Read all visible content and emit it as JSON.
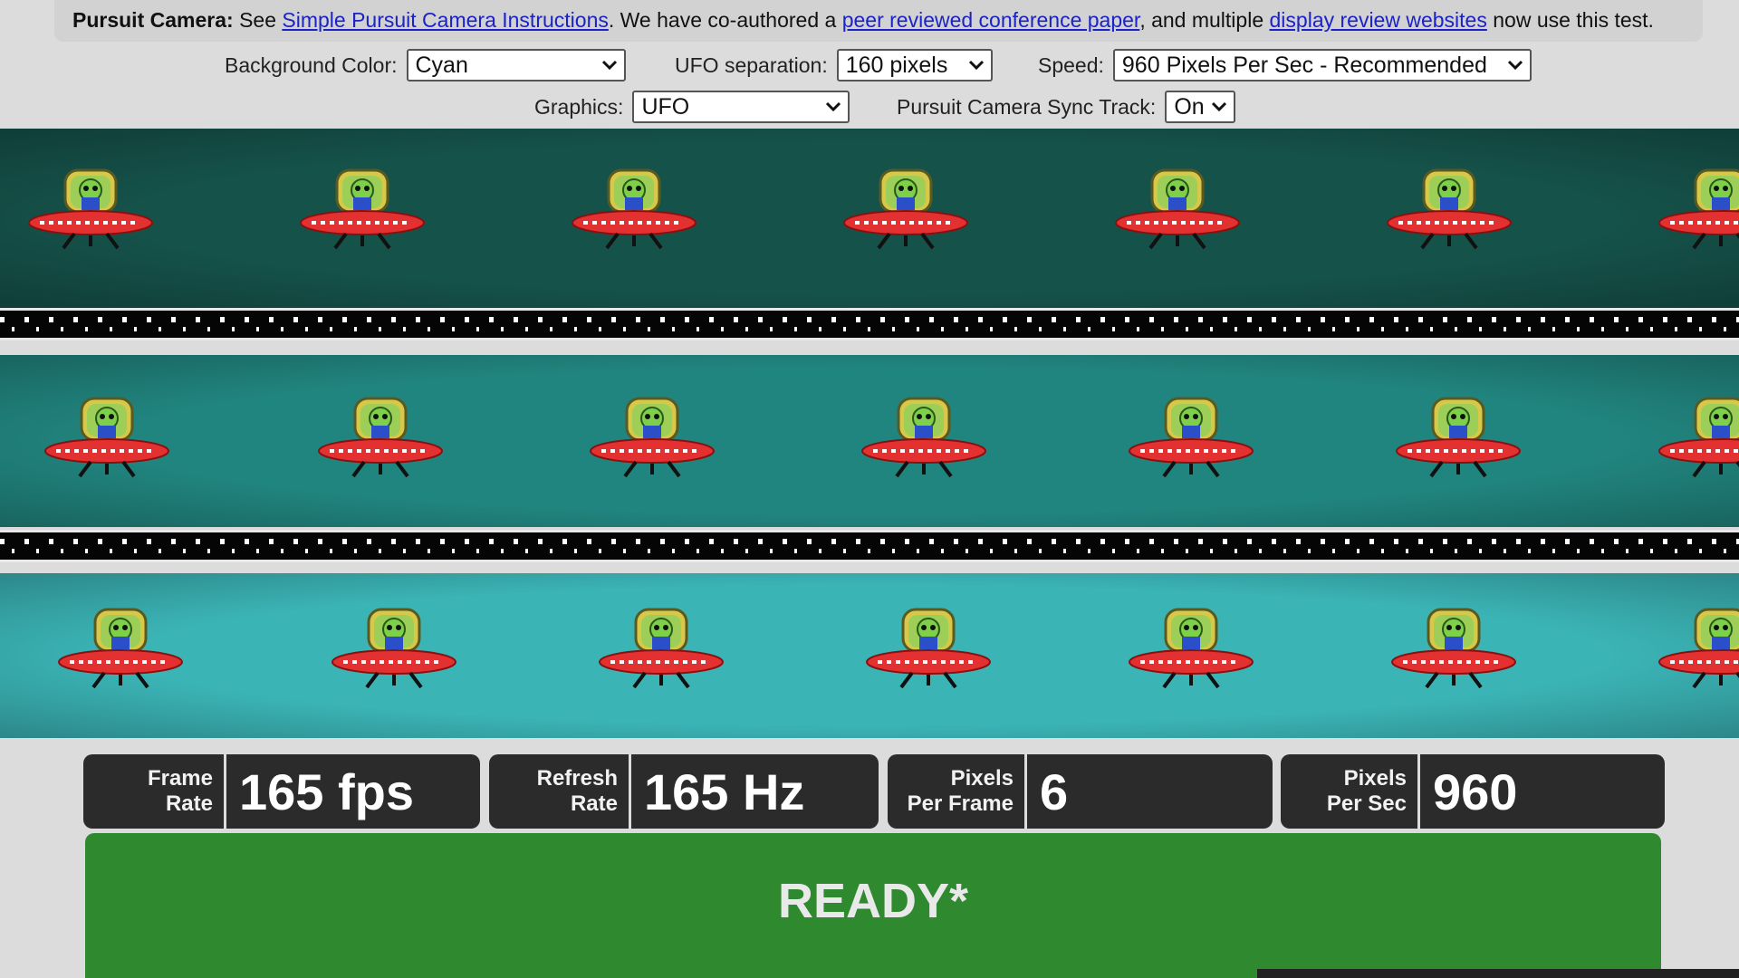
{
  "header": {
    "intro_bold": "Pursuit Camera:",
    "see": "See",
    "link1": "Simple Pursuit Camera Instructions",
    "text2": ". We have co-authored a",
    "link2": "peer reviewed conference paper",
    "text3": ", and multiple",
    "link3": "display review websites",
    "text4": "now use this test."
  },
  "controls": {
    "background_color": {
      "label": "Background Color:",
      "value": "Cyan"
    },
    "ufo_separation": {
      "label": "UFO separation:",
      "value": "160 pixels"
    },
    "speed": {
      "label": "Speed:",
      "value": "960 Pixels Per Sec - Recommended"
    },
    "graphics": {
      "label": "Graphics:",
      "value": "UFO"
    },
    "sync_track": {
      "label": "Pursuit Camera Sync Track:",
      "value": "On"
    }
  },
  "tracks": [
    {
      "color": "#15524a"
    },
    {
      "color": "#21857f"
    },
    {
      "color": "#3bb4b6"
    }
  ],
  "stats": {
    "frame_rate": {
      "label1": "Frame",
      "label2": "Rate",
      "value": "165 fps"
    },
    "refresh_rate": {
      "label1": "Refresh",
      "label2": "Rate",
      "value": "165 Hz"
    },
    "pixels_per_frame": {
      "label1": "Pixels",
      "label2": "Per Frame",
      "value": "6"
    },
    "pixels_per_sec": {
      "label1": "Pixels",
      "label2": "Per Sec",
      "value": "960"
    }
  },
  "status": {
    "text": "READY*",
    "color": "#2f8a2f"
  },
  "icons": {
    "ufo": "ufo-alien-icon",
    "dropdown": "chevron-down-icon"
  }
}
